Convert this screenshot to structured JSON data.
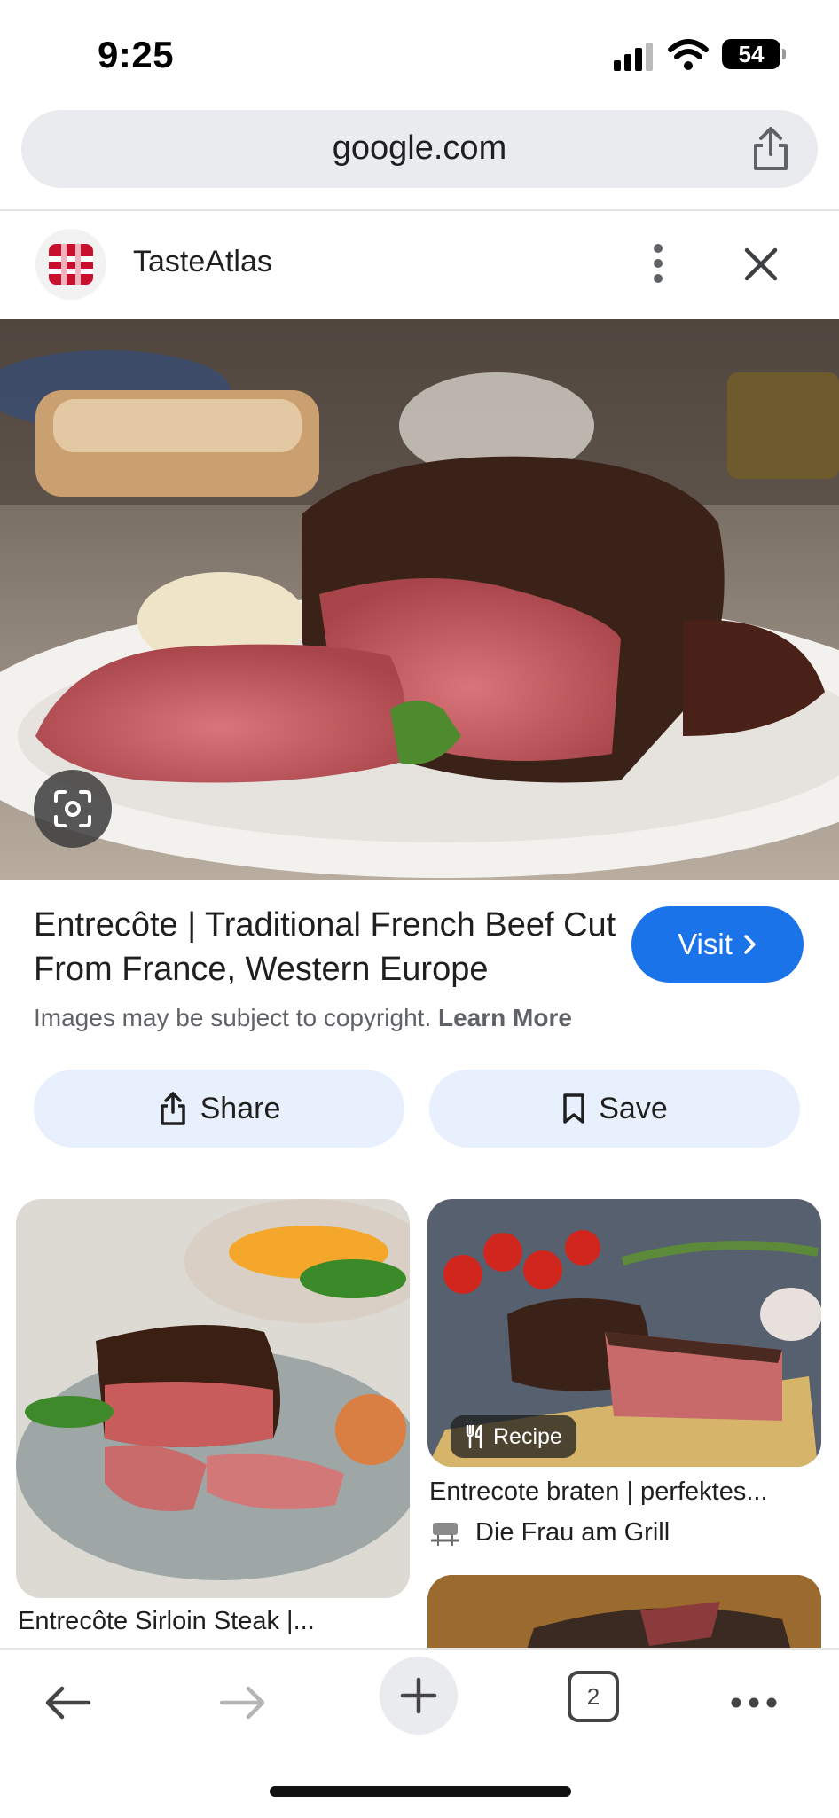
{
  "status_bar": {
    "time": "9:25",
    "battery": "54"
  },
  "url_bar": {
    "url": "google.com",
    "share_icon": "share-icon"
  },
  "source": {
    "name": "TasteAtlas",
    "more_icon": "more-vert-icon",
    "close_icon": "close-icon"
  },
  "main_image": {
    "lens_icon": "lens-icon"
  },
  "result": {
    "title": "Entrecôte | Traditional French Beef Cut From France, Western Europe",
    "visit_label": "Visit",
    "copyright_text": "Images may be subject to copyright.",
    "learn_more": "Learn More",
    "share_label": "Share",
    "save_label": "Save"
  },
  "related": [
    {
      "title": "Entrecôte Sirloin Steak |..."
    },
    {
      "title": "Entrecote braten | perfektes...",
      "chip": "Recipe",
      "source": "Die Frau am Grill"
    }
  ],
  "bottom_nav": {
    "tab_count": "2"
  },
  "colors": {
    "accent": "#1a73e8",
    "pill": "#e8f0fe",
    "urlbar": "#e9ebee"
  }
}
